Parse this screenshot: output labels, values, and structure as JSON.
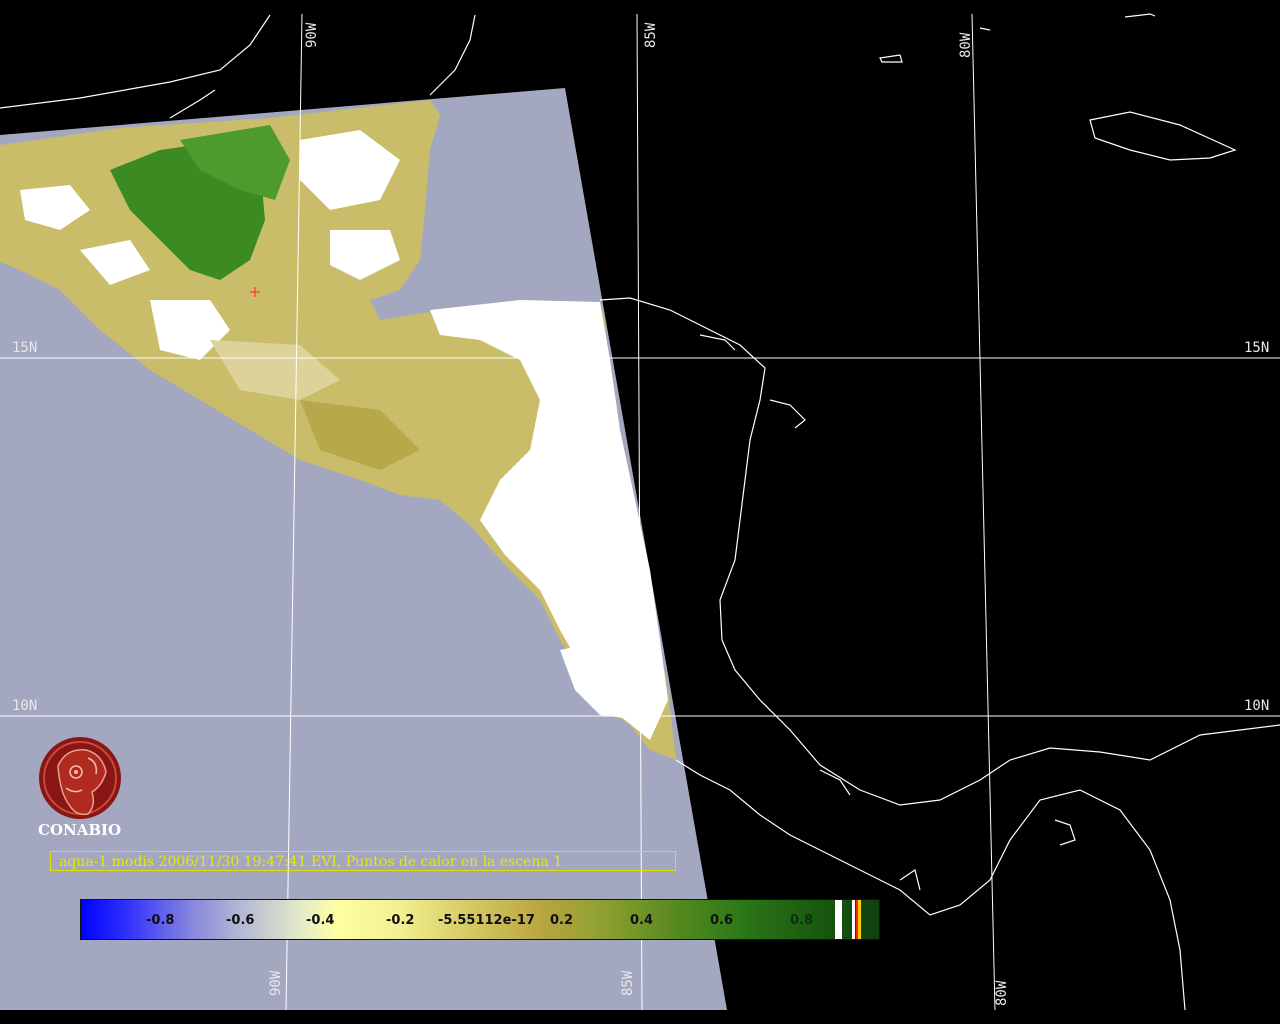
{
  "map": {
    "grid_labels": {
      "lon_top": [
        "90W",
        "85W",
        "80W"
      ],
      "lon_bottom": [
        "90W",
        "85W",
        "80W"
      ],
      "lat_left": [
        "15N",
        "10N"
      ],
      "lat_right": [
        "15N",
        "10N"
      ]
    },
    "colors": {
      "ocean_in_scene": "#a3a8c0",
      "background": "#000000",
      "coastline": "#ffffff",
      "grid": "#ffffff",
      "caption": "#e8e800"
    }
  },
  "logo": {
    "text": "CONABIO",
    "icon": "conabio-macaw-logo"
  },
  "caption": {
    "text": "aqua-1 modis 2006/11/30 19:47:41 EVI, Puntos de calor en la escena 1"
  },
  "colorbar": {
    "ticks": [
      "-0.8",
      "-0.6",
      "-0.4",
      "-0.2",
      "-5.55112e-17",
      "0.2",
      "0.4",
      "0.6",
      "0.8"
    ],
    "range": [
      -1,
      1
    ]
  }
}
